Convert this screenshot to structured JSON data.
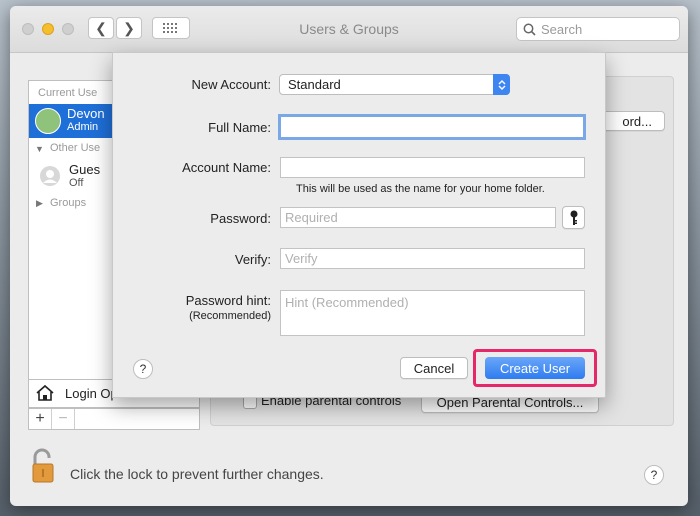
{
  "window": {
    "title": "Users & Groups"
  },
  "search": {
    "placeholder": "Search"
  },
  "userlist": {
    "current_users_header": "Current Use",
    "current_user_name": "Devon",
    "current_user_role": "Admin",
    "other_users_header": "Other Use",
    "guest_name": "Gues",
    "guest_status": "Off",
    "groups_label": "Groups",
    "login_options_label": "Login Options"
  },
  "background": {
    "change_password_partial": "ord...",
    "parental_controls_label": "Enable parental controls",
    "open_parental_controls": "Open Parental Controls...",
    "lock_text": "Click the lock to prevent further changes.",
    "add_symbol": "+",
    "remove_symbol": "−",
    "help_symbol": "?"
  },
  "sheet": {
    "new_account_label": "New Account:",
    "new_account_value": "Standard",
    "full_name_label": "Full Name:",
    "full_name_value": "",
    "account_name_label": "Account Name:",
    "account_name_value": "",
    "account_name_note": "This will be used as the name for your home folder.",
    "password_label": "Password:",
    "password_placeholder": "Required",
    "verify_label": "Verify:",
    "verify_placeholder": "Verify",
    "hint_label": "Password hint:",
    "hint_sub_label": "(Recommended)",
    "hint_placeholder": "Hint (Recommended)",
    "help_symbol": "?",
    "cancel_label": "Cancel",
    "create_label": "Create User"
  },
  "colors": {
    "accent": "#2f7cf0",
    "highlight": "#e5286a",
    "selection": "#1f6fd8"
  }
}
